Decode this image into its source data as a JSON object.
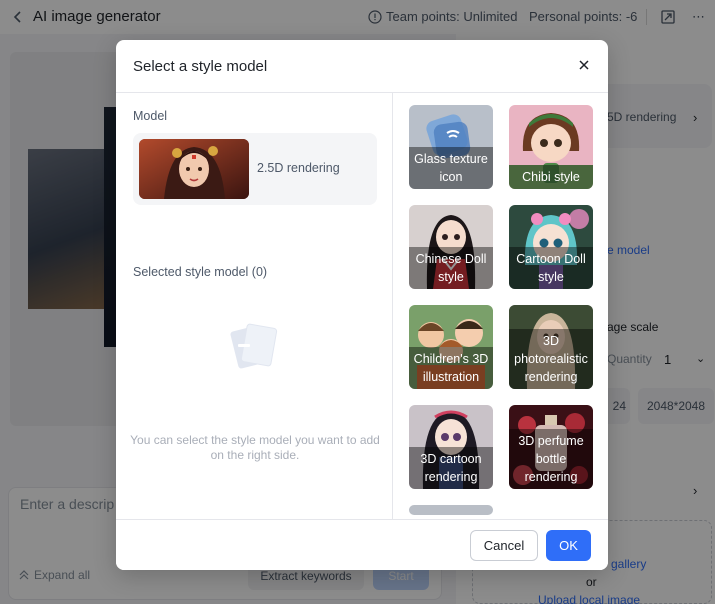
{
  "app": {
    "title": "AI image generator",
    "team_points": "Team points: Unlimited",
    "personal_points": "Personal points: -6"
  },
  "editor": {
    "prompt_placeholder": "Enter a descrip",
    "expand_all": "Expand all",
    "extract_keywords": "Extract keywords",
    "start": "Start"
  },
  "right_panel": {
    "model_value": "5D rendering",
    "style_link": "e model",
    "scale_label": "age scale",
    "quantity_label": "Quantity",
    "quantity_value": "1",
    "size_a": "24",
    "size_b": "2048*2048",
    "gallery_link": "gallery",
    "or_text": "or",
    "upload_local": "Upload local image"
  },
  "modal": {
    "title": "Select a style model",
    "model_label": "Model",
    "current_model": "2.5D rendering",
    "selected_label": "Selected style model (0)",
    "empty_text": "You can select the style model you want to add on the right side.",
    "cancel": "Cancel",
    "ok": "OK",
    "styles": [
      {
        "label": "Glass texture icon",
        "art": "glass"
      },
      {
        "label": "Chibi style",
        "art": "chibi"
      },
      {
        "label": "Chinese Doll style",
        "art": "chinese-doll"
      },
      {
        "label": "Cartoon Doll style",
        "art": "cartoon-doll"
      },
      {
        "label": "Children's 3D illustration",
        "art": "children"
      },
      {
        "label": "3D photorealistic rendering",
        "art": "photoreal"
      },
      {
        "label": "3D cartoon rendering",
        "art": "cartoon3d"
      },
      {
        "label": "3D perfume bottle rendering",
        "art": "perfume"
      }
    ]
  },
  "colors": {
    "accent": "#2f6ef8",
    "overlay": "rgba(0,0,0,0.45)"
  }
}
